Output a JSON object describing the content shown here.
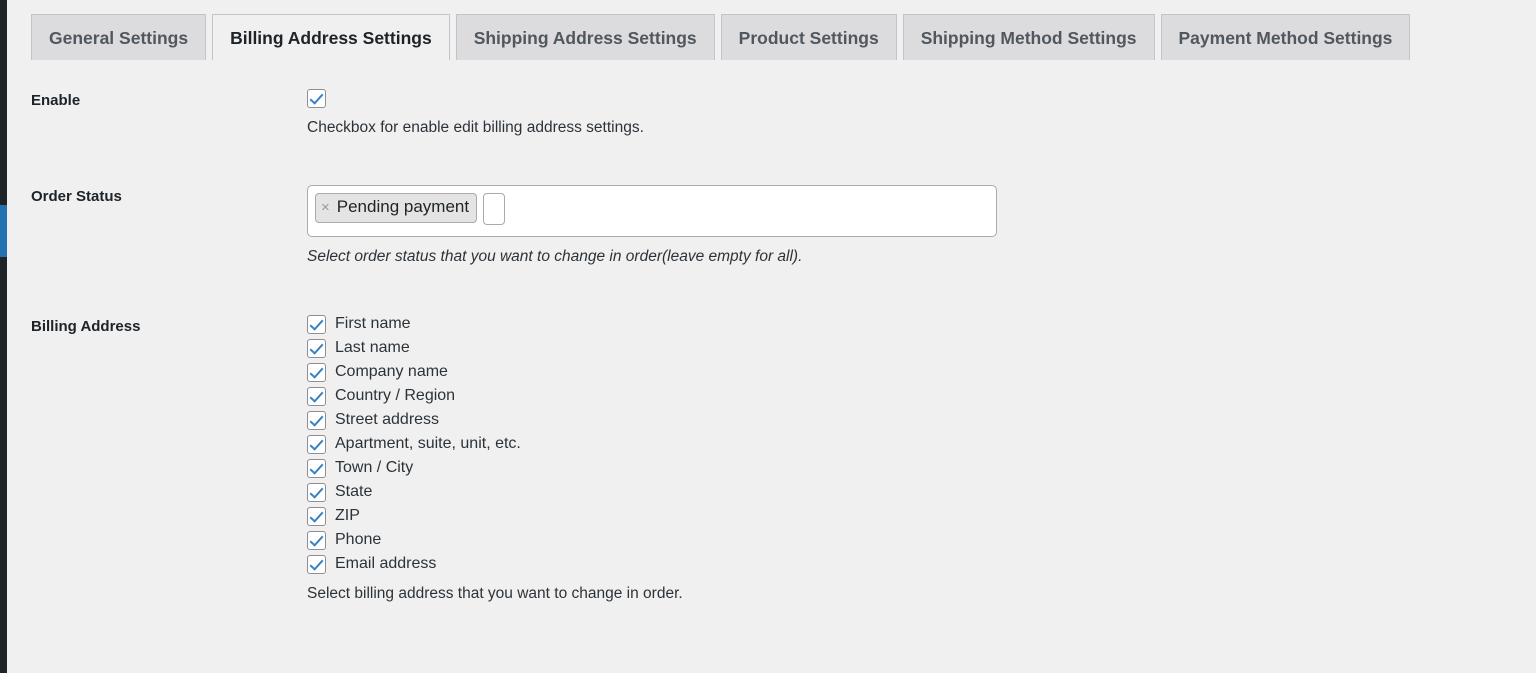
{
  "colors": {
    "rail_bg": "#1d2327",
    "rail_active": "#2271b1",
    "page_bg": "#f0f0f1",
    "tab_inactive_bg": "#dcdcde",
    "tab_active_bg": "#f0f0f1",
    "tab_border": "#c3c4c7",
    "checkbox_check": "#3582c4",
    "text": "#2c3338",
    "label_text": "#1d2327"
  },
  "tabs": [
    {
      "label": "General Settings",
      "active": false
    },
    {
      "label": "Billing Address Settings",
      "active": true
    },
    {
      "label": "Shipping Address Settings",
      "active": false
    },
    {
      "label": "Product Settings",
      "active": false
    },
    {
      "label": "Shipping Method Settings",
      "active": false
    },
    {
      "label": "Payment Method Settings",
      "active": false
    }
  ],
  "rows": {
    "enable": {
      "label": "Enable",
      "checkbox_checked": true,
      "description": "Checkbox for enable edit billing address settings."
    },
    "order_status": {
      "label": "Order Status",
      "tokens": [
        {
          "label": "Pending payment",
          "remove_icon": "close-icon",
          "remove_glyph": "×"
        }
      ],
      "search_value": "",
      "search_placeholder": "",
      "description": "Select order status that you want to change in order(leave empty for all)."
    },
    "billing_address": {
      "label": "Billing Address",
      "options": [
        {
          "label": "First name",
          "checked": true
        },
        {
          "label": "Last name",
          "checked": true
        },
        {
          "label": "Company name",
          "checked": true
        },
        {
          "label": "Country / Region",
          "checked": true
        },
        {
          "label": "Street address",
          "checked": true
        },
        {
          "label": "Apartment, suite, unit, etc.",
          "checked": true
        },
        {
          "label": "Town / City",
          "checked": true
        },
        {
          "label": "State",
          "checked": true
        },
        {
          "label": "ZIP",
          "checked": true
        },
        {
          "label": "Phone",
          "checked": true
        },
        {
          "label": "Email address",
          "checked": true
        }
      ],
      "description": "Select billing address that you want to change in order."
    }
  }
}
